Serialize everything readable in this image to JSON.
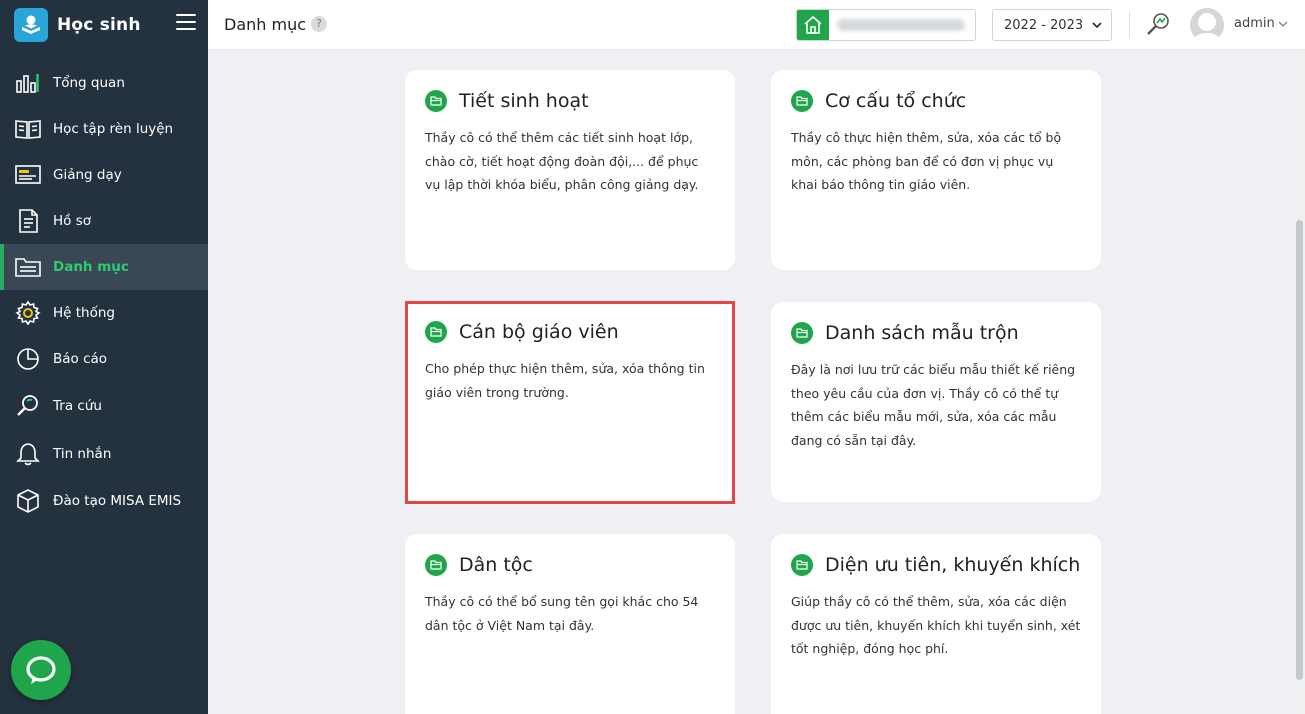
{
  "sidebar": {
    "brand": "Học sinh",
    "items": [
      {
        "label": "Tổng quan",
        "icon": "bar-chart-icon",
        "active": false
      },
      {
        "label": "Học tập rèn luyện",
        "icon": "open-book-icon",
        "active": false
      },
      {
        "label": "Giảng dạy",
        "icon": "presentation-board-icon",
        "active": false
      },
      {
        "label": "Hồ sơ",
        "icon": "document-icon",
        "active": false
      },
      {
        "label": "Danh mục",
        "icon": "folder-icon",
        "active": true
      },
      {
        "label": "Hệ thống",
        "icon": "gear-icon",
        "active": false
      },
      {
        "label": "Báo cáo",
        "icon": "pie-chart-icon",
        "active": false
      },
      {
        "label": "Tra cứu",
        "icon": "search-icon",
        "active": false
      },
      {
        "label": "Tin nhắn",
        "icon": "bell-icon",
        "active": false
      },
      {
        "label": "Đào tạo MISA EMIS",
        "icon": "cube-icon",
        "active": false
      }
    ]
  },
  "header": {
    "title": "Danh mục",
    "help": "?",
    "school_year": "2022 - 2023",
    "user": "admin"
  },
  "cards": [
    {
      "title": "Tiết sinh hoạt",
      "desc": "Thầy cô có thể thêm các tiết sinh hoạt lớp, chào cờ, tiết hoạt động đoàn đội,... để phục vụ lập thời khóa biểu, phân công giảng dạy."
    },
    {
      "title": "Cơ cấu tổ chức",
      "desc": "Thầy cô thực hiện thêm, sửa, xóa các tổ bộ môn, các phòng ban để có đơn vị phục vụ khai báo thông tin giáo viên."
    },
    {
      "title": "Cán bộ giáo viên",
      "desc": "Cho phép thực hiện thêm, sửa, xóa thông tin giáo viên trong trường.",
      "highlighted": true
    },
    {
      "title": "Danh sách mẫu trộn",
      "desc": "Đây là nơi lưu trữ các biểu mẫu thiết kế riêng theo yêu cầu của đơn vị. Thầy cô có thể tự thêm các biểu mẫu mới, sửa, xóa các mẫu đang có sẵn tại đây."
    },
    {
      "title": "Dân tộc",
      "desc": "Thầy cô có thể bổ sung tên gọi khác cho 54 dân tộc ở Việt Nam tại đây."
    },
    {
      "title": "Diện ưu tiên, khuyến khích",
      "desc": "Giúp thầy cô có thể thêm, sửa, xóa các diện được ưu tiên, khuyến khích khi tuyển sinh, xét tốt nghiệp, đóng học phí."
    }
  ],
  "colors": {
    "accent": "#1fa64a",
    "sidebar": "#24313f",
    "highlight": "#e4454b"
  }
}
